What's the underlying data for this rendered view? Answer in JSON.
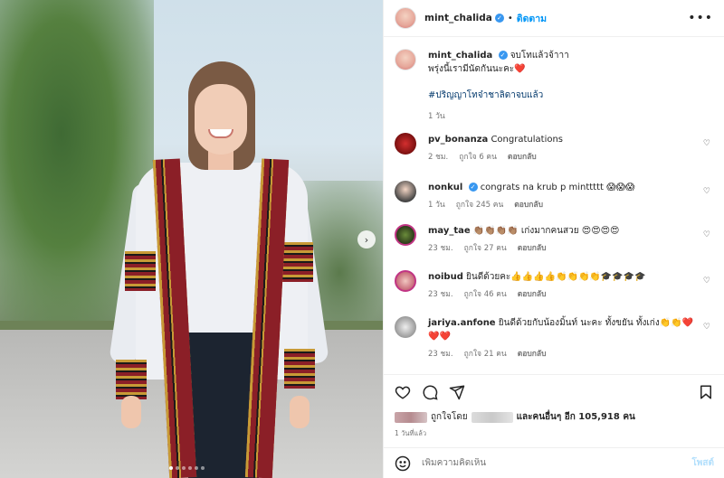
{
  "header": {
    "username": "mint_chalida",
    "follow_label": "ติดตาม",
    "more_icon": "more-horizontal-icon"
  },
  "caption": {
    "username": "mint_chalida",
    "line1": "จบโทแล้วจ้าาา",
    "line2": "พรุ่งนี้เรามีนัดกันนะคะ",
    "line2_emoji": "❤️",
    "hashtag": "#ปริญญาโทจ๋าชาลิดาจบแล้ว",
    "time": "1 วัน"
  },
  "comments": [
    {
      "username": "pv_bonanza",
      "text": "Congratulations",
      "time": "2 ชม.",
      "likes": "ถูกใจ 6 คน",
      "reply": "ตอบกลับ",
      "verified": false
    },
    {
      "username": "nonkul",
      "text": "congrats na krub p minttttt 😱😱😱",
      "time": "1 วัน",
      "likes": "ถูกใจ 245 คน",
      "reply": "ตอบกลับ",
      "verified": true
    },
    {
      "username": "may_tae",
      "text": "👏🏽👏🏽👏🏽👏🏽 เก่งมากคนสวย 😍😍😍😍",
      "time": "23 ชม.",
      "likes": "ถูกใจ 27 คน",
      "reply": "ตอบกลับ",
      "verified": false
    },
    {
      "username": "noibud",
      "text": "ยินดีด้วยคะ👍👍👍👍👏👏👏👏🎓🎓🎓🎓",
      "time": "23 ชม.",
      "likes": "ถูกใจ 46 คน",
      "reply": "ตอบกลับ",
      "verified": false
    },
    {
      "username": "jariya.anfone",
      "text": "ยินดีด้วยกับน้องมิ้นท์ นะคะ ทั้งขยัน ทั้งเก่ง👏👏❤️❤️❤️",
      "time": "23 ชม.",
      "likes": "ถูกใจ 21 คน",
      "reply": "ตอบกลับ",
      "verified": false
    }
  ],
  "likes_summary": {
    "liked_by": "ถูกใจโดย",
    "and_others": "และคนอื่นๆ อีก 105,918 คน"
  },
  "post_time": "1 วันที่แล้ว",
  "add_comment": {
    "placeholder": "เพิ่มความคิดเห็น",
    "post_label": "โพสต์"
  },
  "carousel": {
    "next_icon": "chevron-right-icon",
    "slide_count": 6,
    "active_index": 0
  },
  "colors": {
    "accent": "#0095f6",
    "verified": "#3897f0",
    "hashtag": "#00376b",
    "muted": "#737373"
  }
}
